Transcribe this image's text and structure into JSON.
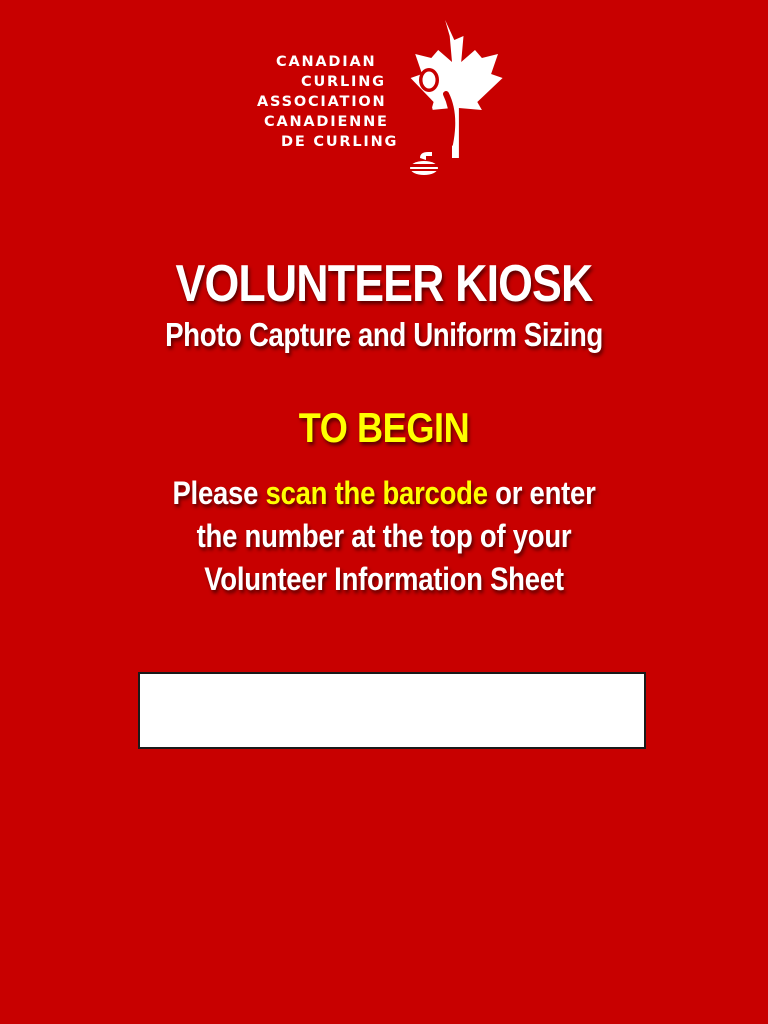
{
  "logo": {
    "lines": [
      "CANADIAN",
      "CURLING",
      "ASSOCIATION",
      "CANADIENNE",
      "DE CURLING"
    ],
    "icon": "maple-leaf-curler-icon"
  },
  "header": {
    "title": "VOLUNTEER KIOSK",
    "subtitle": "Photo Capture and Uniform Sizing"
  },
  "prompt": {
    "heading": "TO BEGIN",
    "line1_a": "Please ",
    "line1_highlight": "scan the barcode",
    "line1_b": " or enter",
    "line2": "the number at the top of your",
    "line3": "Volunteer Information Sheet"
  },
  "barcode_field": {
    "value": "",
    "placeholder": ""
  },
  "colors": {
    "background": "#c80000",
    "text": "#ffffff",
    "highlight": "#ffff00",
    "input_bg": "#ffffff"
  }
}
